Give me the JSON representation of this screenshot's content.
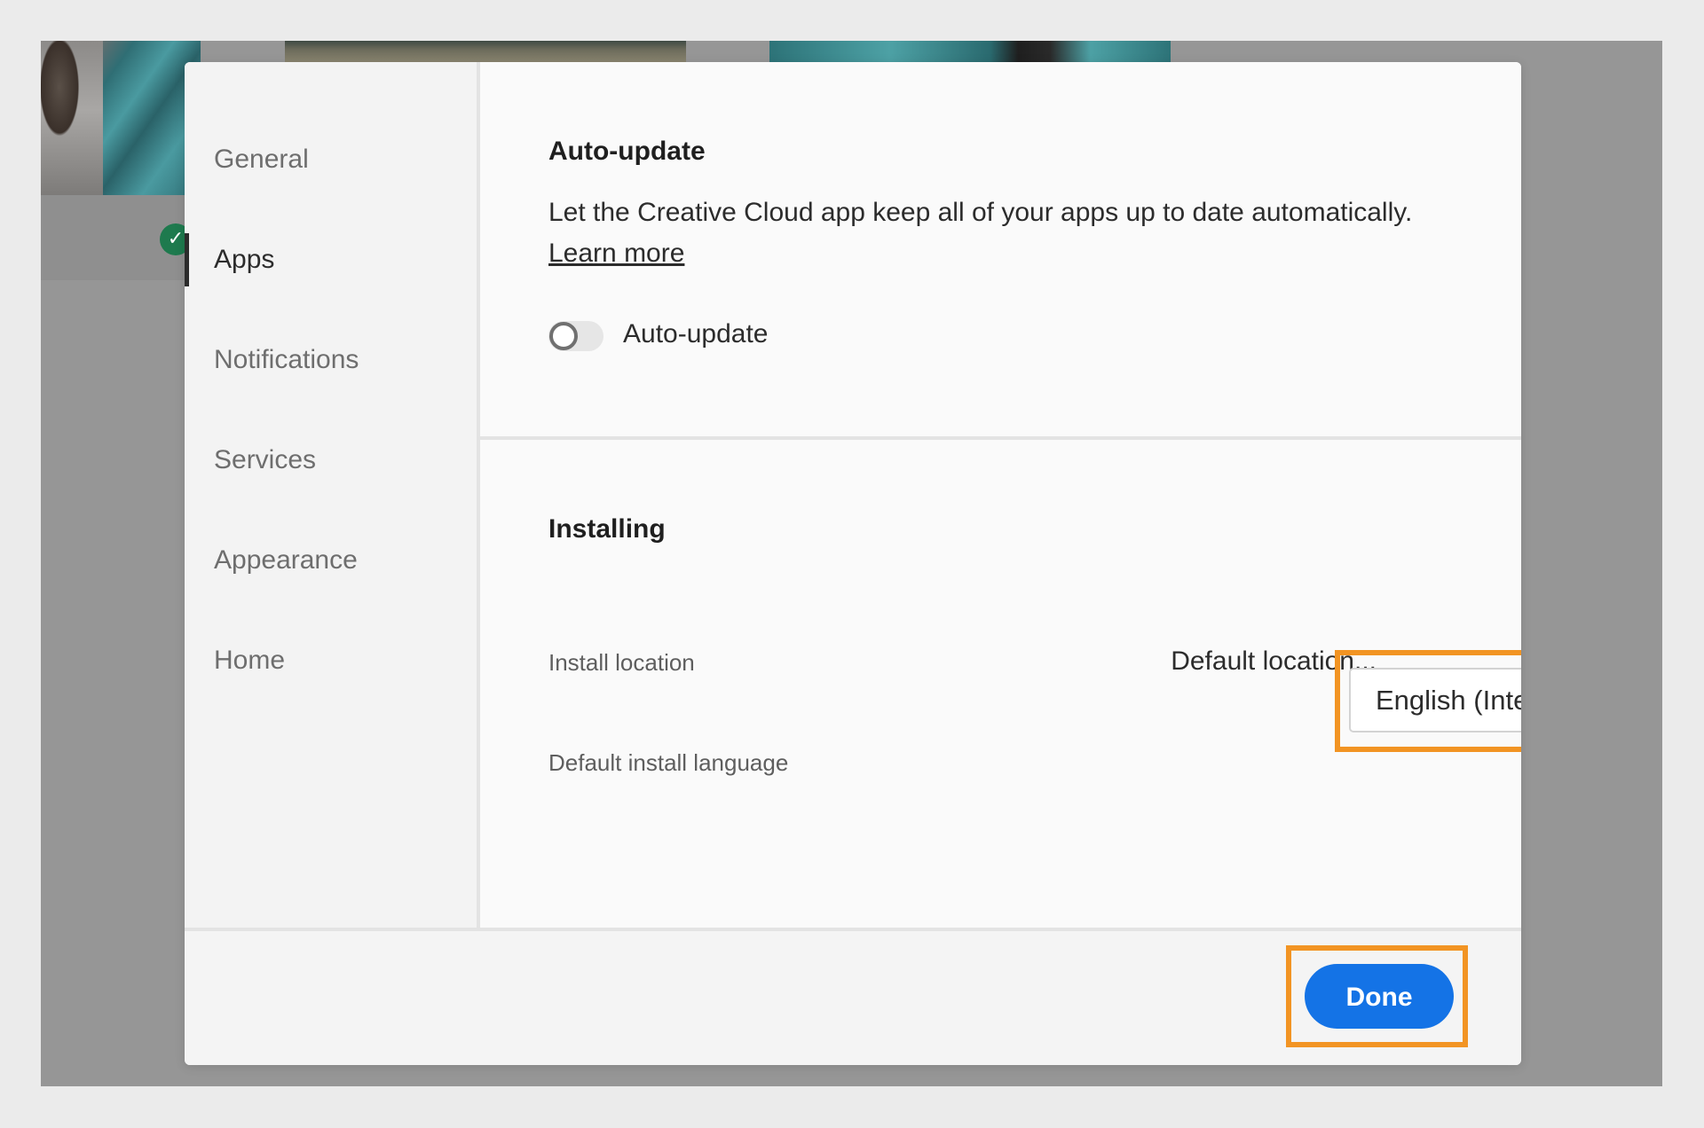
{
  "sidebar": {
    "items": [
      {
        "id": "general",
        "label": "General"
      },
      {
        "id": "apps",
        "label": "Apps",
        "active": true
      },
      {
        "id": "notifications",
        "label": "Notifications"
      },
      {
        "id": "services",
        "label": "Services"
      },
      {
        "id": "appearance",
        "label": "Appearance"
      },
      {
        "id": "home",
        "label": "Home"
      }
    ]
  },
  "auto_update": {
    "title": "Auto-update",
    "description": "Let the Creative Cloud app keep all of your apps up to date automatically.",
    "learn_more": "Learn more",
    "toggle_label": "Auto-update",
    "toggle_state": "off"
  },
  "installing": {
    "title": "Installing",
    "install_location_label": "Install location",
    "install_location_value": "Default location...",
    "install_location_edit_icon": "pencil-icon",
    "language_label": "Default install language",
    "language_value": "English (International)",
    "language_dropdown_icon": "chevron-down-icon"
  },
  "footer": {
    "done_label": "Done"
  },
  "colors": {
    "accent": "#1473e6",
    "highlight": "#f29423",
    "check_badge": "#1e7a4e"
  }
}
